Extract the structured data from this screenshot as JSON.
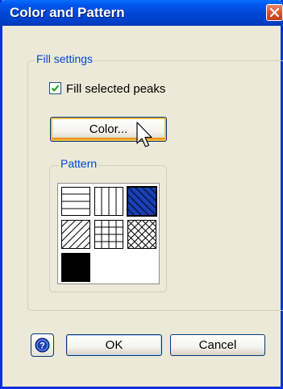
{
  "window": {
    "title": "Color and Pattern"
  },
  "fill_settings": {
    "legend": "Fill settings",
    "checkbox_label": "Fill selected peaks",
    "checkbox_checked": true,
    "color_button_label": "Color..."
  },
  "pattern": {
    "legend": "Pattern",
    "swatches": [
      {
        "name": "horizontal-lines-swatch"
      },
      {
        "name": "vertical-lines-swatch"
      },
      {
        "name": "blue-diagonal-lines-swatch",
        "selected": true,
        "color": "#1A40B8"
      },
      {
        "name": "forward-diagonal-lines-swatch"
      },
      {
        "name": "grid-swatch"
      },
      {
        "name": "crosshatch-swatch"
      },
      {
        "name": "solid-black-swatch"
      }
    ]
  },
  "buttons": {
    "ok": "OK",
    "cancel": "Cancel"
  },
  "icons": {
    "help": "help-icon",
    "close": "close-icon"
  }
}
